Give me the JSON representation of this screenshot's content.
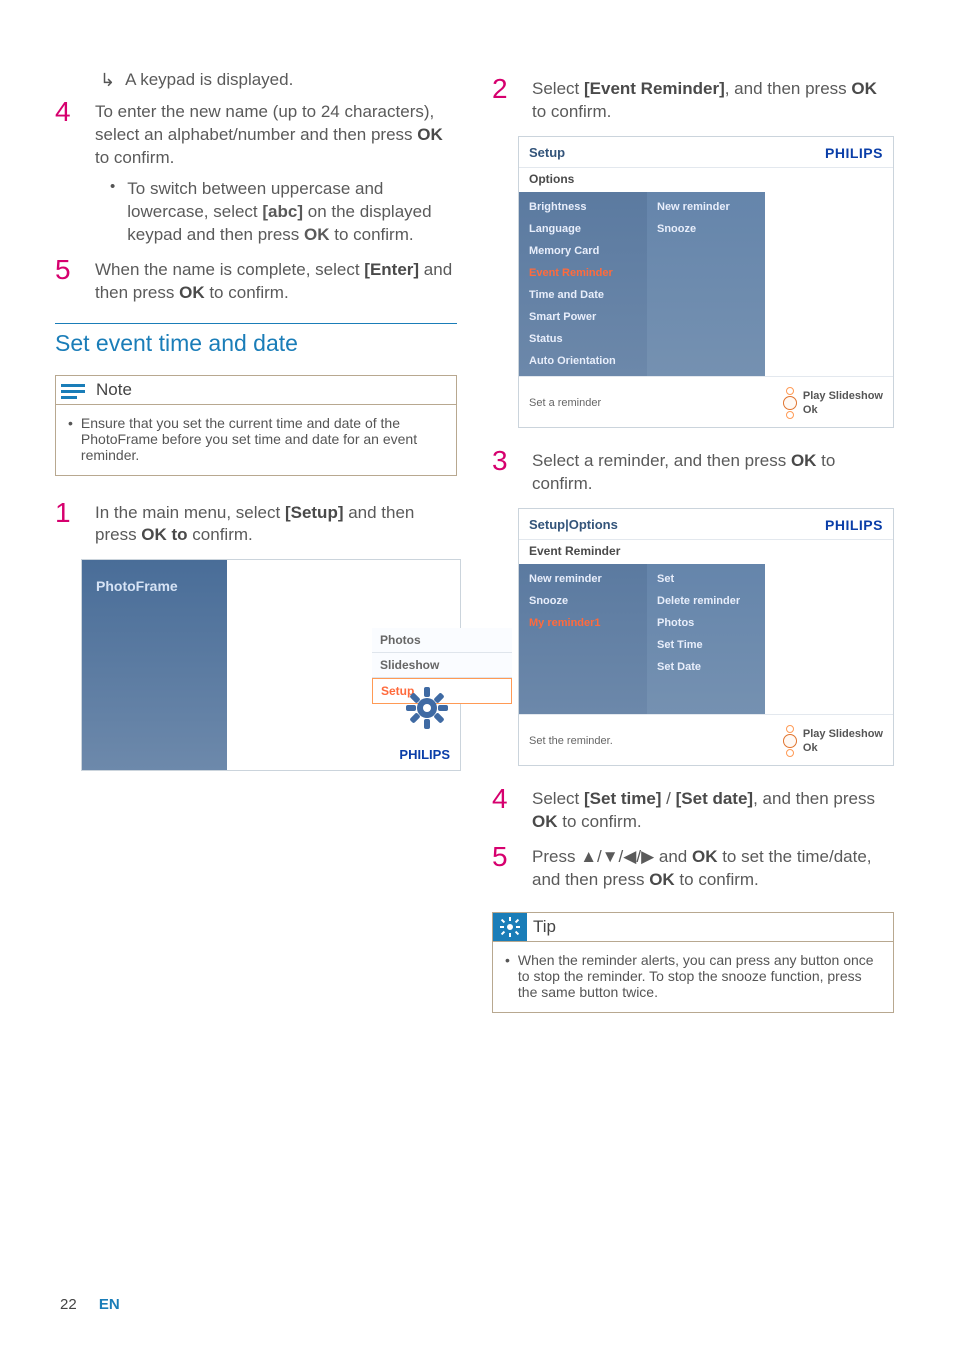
{
  "left": {
    "result1": "A keypad is displayed.",
    "step4_a": "To enter the new name (up to 24 characters), select an alphabet/number and then press ",
    "step4_b": "OK",
    "step4_c": " to confirm.",
    "sub1_a": "To switch between uppercase and lowercase, select ",
    "sub1_b": "[abc]",
    "sub1_c": " on the displayed keypad and then press ",
    "sub1_d": "OK",
    "sub1_e": " to confirm.",
    "step5_a": "When the name is complete, select ",
    "step5_b": "[Enter]",
    "step5_c": " and then press ",
    "step5_d": "OK",
    "step5_e": " to confirm.",
    "section": "Set event time and date",
    "note_title": "Note",
    "note_body": "Ensure that you set the current time and date of the PhotoFrame before you set time and date for an event reminder.",
    "lstep1_a": "In the main menu, select ",
    "lstep1_b": "[Setup]",
    "lstep1_c": " and then press ",
    "lstep1_d": "OK to",
    "lstep1_e": " confirm.",
    "frame1": {
      "title": "PhotoFrame",
      "menu": [
        "Photos",
        "Slideshow",
        "Setup"
      ],
      "brand": "PHILIPS"
    },
    "n4": "4",
    "n5": "5",
    "n1": "1"
  },
  "right": {
    "step2_a": "Select ",
    "step2_b": "[Event Reminder]",
    "step2_c": ", and then press ",
    "step2_d": "OK",
    "step2_e": " to confirm.",
    "n2": "2",
    "s2": {
      "title": "Setup",
      "brand": "PHILIPS",
      "sub": "Options",
      "col1": [
        "Brightness",
        "Language",
        "Memory Card",
        "Event Reminder",
        "Time and Date",
        "Smart Power",
        "Status",
        "Auto Orientation"
      ],
      "col2": [
        "New reminder",
        "Snooze"
      ],
      "hint": "Set a reminder",
      "play": "Play Slideshow",
      "ok": "Ok"
    },
    "step3_a": "Select a reminder, and then press ",
    "step3_b": "OK",
    "step3_c": " to confirm.",
    "n3": "3",
    "s3": {
      "title": "Setup|Options",
      "brand": "PHILIPS",
      "sub": "Event Reminder",
      "col1": [
        "New reminder",
        "Snooze",
        "My reminder1"
      ],
      "col2": [
        "Set",
        "Delete reminder",
        "Photos",
        "Set Time",
        "Set Date"
      ],
      "hint": "Set the reminder.",
      "play": "Play Slideshow",
      "ok": "Ok"
    },
    "step4_a": "Select ",
    "step4_b": "[Set time]",
    "step4_c": " / ",
    "step4_d": "[Set date]",
    "step4_e": ", and then press ",
    "step4_f": "OK",
    "step4_g": " to confirm.",
    "n4": "4",
    "step5_a": "Press ",
    "step5_b": "▲/▼/◀/▶",
    "step5_c": " and ",
    "step5_d": "OK",
    "step5_e": " to set the time/date, and then press ",
    "step5_f": "OK",
    "step5_g": " to confirm.",
    "n5": "5",
    "tip_title": "Tip",
    "tip_body": "When the reminder alerts, you can press any button once to stop the reminder. To stop the snooze function, press the same button twice."
  },
  "footer": {
    "page": "22",
    "lang": "EN"
  }
}
